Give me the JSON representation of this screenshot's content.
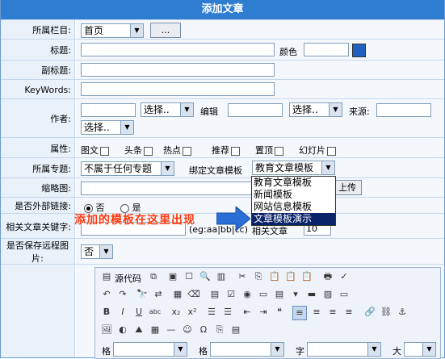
{
  "title": "添加文章",
  "labels": {
    "category": "所属栏目:",
    "title": "标题:",
    "color": "颜色",
    "subtitle": "副标题:",
    "keywords": "KeyWords:",
    "author": "作者:",
    "editor": "编辑",
    "source": "来源:",
    "attribute": "属性:",
    "topic": "所属专题:",
    "bind_template": "绑定文章模板",
    "thumb": "缩略图:",
    "external": "是否外部链接:",
    "related": "相关文章关键字:",
    "related_tail": "(eg:aa|bb|cc)",
    "related_mid": "相关文章",
    "related_num": "10",
    "save_remote": "是否保存远程图片:"
  },
  "category_select": "首页",
  "browse_btn": "...",
  "choose": "选择..",
  "attributes": [
    "图文",
    "头条",
    "热点",
    "推荐",
    "置顶",
    "幻灯片"
  ],
  "topic_select": "不属于任何专题",
  "template_select": "教育文章模板",
  "template_options": [
    "教育文章模板",
    "新闻模板",
    "网站信息模板",
    "文章模板演示"
  ],
  "upload_btn": "上传",
  "radio_no": "否",
  "radio_yes": "是",
  "save_remote_select": "否",
  "overlay_text": "添加的模板在这里出现",
  "source_code_btn": "源代码",
  "editor_fields": [
    "格",
    "格",
    "字",
    "大"
  ],
  "colors": {
    "header": "#2f7dd0",
    "label_bg": "#e9f2fb",
    "highlight": "#0a246a",
    "overlay": "#ff3a10",
    "arrow": "#2a6fd6"
  }
}
